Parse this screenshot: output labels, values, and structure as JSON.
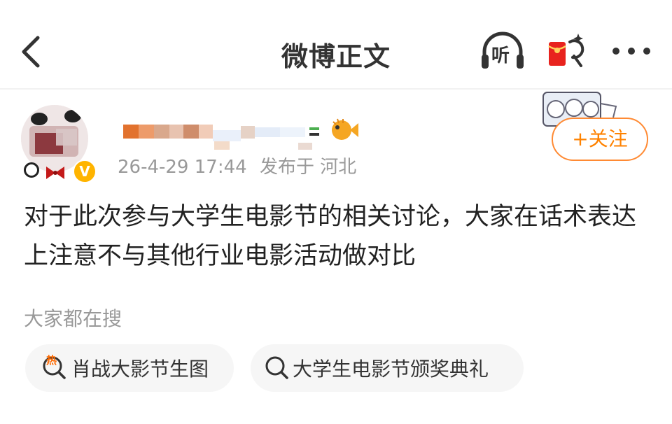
{
  "header": {
    "title": "微博正文",
    "listen_label": "听"
  },
  "post": {
    "timestamp": "26-4-29 17:44",
    "published_from": "发布于 河北",
    "follow_label": "+关注",
    "verified_mark": "V",
    "text": "对于此次参与大学生电影节的相关讨论，大家在话术表达上注意不与其他行业电影活动做对比"
  },
  "search": {
    "section_title": "大家都在搜",
    "tags": [
      {
        "label": "肖战大影节生图",
        "badge": "热",
        "icon": "hot-search-icon"
      },
      {
        "label": "大学生电影节颁奖典礼",
        "icon": "search-icon"
      }
    ]
  },
  "colors": {
    "accent": "#ff8200",
    "verified": "#ffb400",
    "redpacket": "#e8231e"
  }
}
